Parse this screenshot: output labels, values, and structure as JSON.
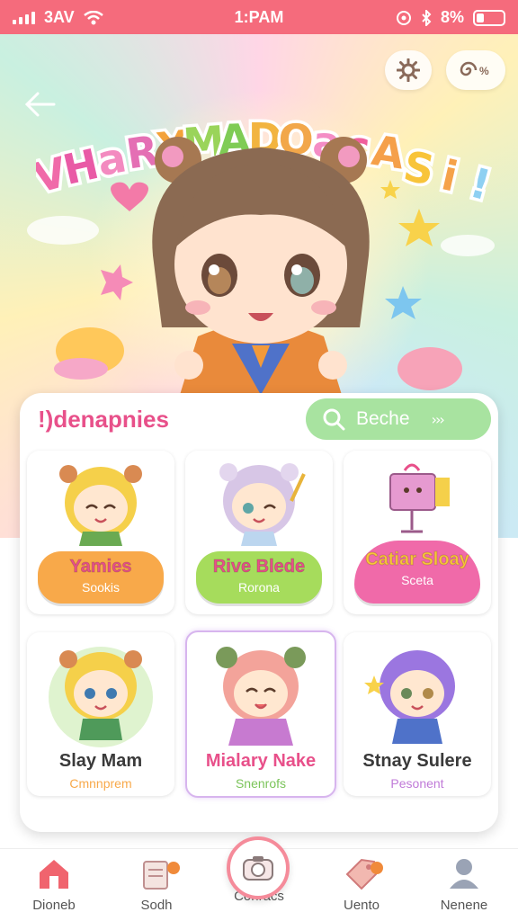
{
  "status_bar": {
    "carrier": "3AV",
    "time": "1:PAM",
    "battery": "8%"
  },
  "hero": {
    "title_letters": [
      "V",
      "H",
      "a",
      "R",
      "Y",
      "M",
      "A",
      "D",
      "O",
      "a",
      "c",
      "A",
      "S",
      "i",
      "!"
    ],
    "title_colors": [
      "#f06aa9",
      "#e95aa6",
      "#f38ac0",
      "#e46fb4",
      "#f3a23a",
      "#9ad45a",
      "#7fcc55",
      "#f2b440",
      "#f2a74a",
      "#f48dc5",
      "#f05f9d",
      "#f5a04a",
      "#f8c43a",
      "#f5a24a",
      "#8ed0f2"
    ]
  },
  "panel": {
    "title": "!)denapnies",
    "search_label": "Beche",
    "search_arrows": "›››"
  },
  "cards": [
    {
      "name": "Yamies",
      "sub": "Sookis"
    },
    {
      "name": "Rive Blede",
      "sub": "Rorona"
    },
    {
      "name": "Catiar Sloay",
      "sub": "Sceta"
    },
    {
      "name": "Slay Mam",
      "sub": "Cmnnprem"
    },
    {
      "name": "Mialary Nake",
      "sub": "Snenrofs"
    },
    {
      "name": "Stnay Sulere",
      "sub": "Pesonent"
    }
  ],
  "nav": [
    {
      "label": "Dioneb"
    },
    {
      "label": "Sodh"
    },
    {
      "label": "Conracs"
    },
    {
      "label": "Uento"
    },
    {
      "label": "Nenene"
    }
  ],
  "colors": {
    "accent": "#f56b7c",
    "orange": "#f8a94a",
    "lime": "#a6dc5c",
    "pink": "#f06aa9",
    "purple": "#9b76e0"
  }
}
